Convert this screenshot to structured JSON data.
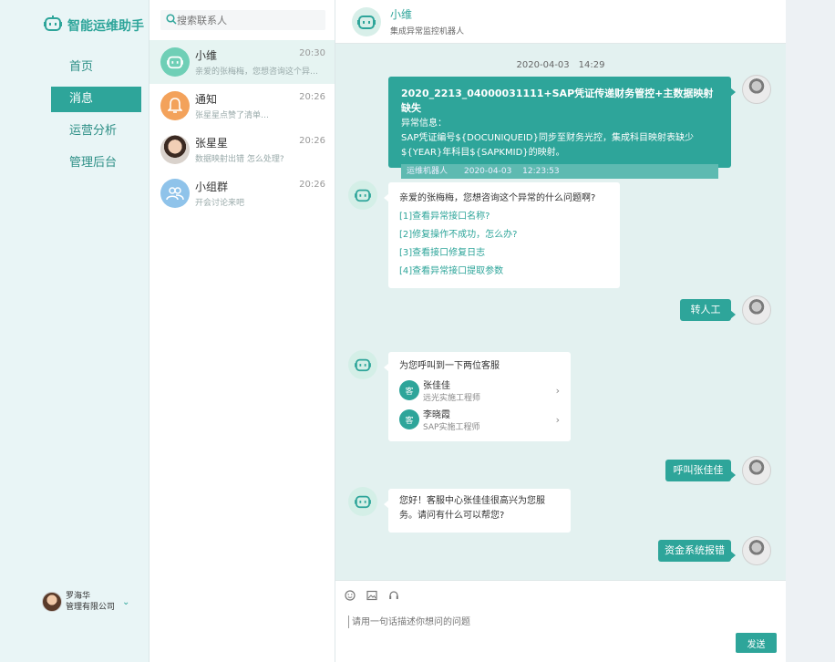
{
  "app": {
    "title": "智能运维助手"
  },
  "nav": {
    "items": [
      {
        "label": "首页",
        "active": false
      },
      {
        "label": "消息",
        "active": true
      },
      {
        "label": "运营分析",
        "active": false
      },
      {
        "label": "管理后台",
        "active": false
      }
    ]
  },
  "user": {
    "name": "罗海华",
    "company": "管理有限公司"
  },
  "search": {
    "placeholder": "搜索联系人"
  },
  "contacts": [
    {
      "name": "小维",
      "preview": "亲爱的张梅梅，您想咨询这个异…",
      "time": "20:30",
      "avatar": "robot-icon",
      "color": "#6fcfb6"
    },
    {
      "name": "通知",
      "preview": "张星星点赞了清单…",
      "time": "20:26",
      "avatar": "bell-icon",
      "color": "#f3a25b"
    },
    {
      "name": "张星星",
      "preview": "数据映射出错 怎么处理?",
      "time": "20:26",
      "avatar": "person-photo",
      "color": "#d9c4b0"
    },
    {
      "name": "小组群",
      "preview": "开会讨论来吧",
      "time": "20:26",
      "avatar": "group-icon",
      "color": "#8fc3ea"
    }
  ],
  "chat": {
    "title": "小维",
    "subtitle": "集成异常监控机器人",
    "timestamp": "2020-04-03　14:29",
    "alert": {
      "title": "2020_2213_04000031111+SAP凭证传递财务管控+主数据映射缺失",
      "label": "异常信息：",
      "line1": "SAP凭证编号${DOCUNIQUEID}同步至财务光控，集成科目映射表缺少",
      "line2": "${YEAR}年科目${SAPKMID}的映射。",
      "footer": "运维机器人　　2020-04-03　 12:23:53"
    },
    "question": {
      "text": "亲爱的张梅梅，您想咨询这个异常的什么问题啊?",
      "options": [
        "[1]查看异常接口名称?",
        "[2]修复操作不成功，怎么办?",
        "[3]查看接口修复日志",
        "[4]查看异常接口提取参数"
      ]
    },
    "reply1": "转人工",
    "agents": {
      "text": "为您呼叫到一下两位客服",
      "badge": "客",
      "list": [
        {
          "name": "张佳佳",
          "role": "远光实施工程师"
        },
        {
          "name": "李晓霞",
          "role": "SAP实施工程师"
        }
      ]
    },
    "reply2": "呼叫张佳佳",
    "greeting": {
      "line1": "您好！客服中心张佳佳很高兴为您服",
      "line2": "务。请问有什么可以帮您?"
    },
    "reply3": "资金系统报错"
  },
  "compose": {
    "placeholder": "请用一句话描述你想问的问题",
    "send": "发送"
  },
  "colors": {
    "accent": "#2ea59a",
    "chat_bg": "#e3f1f0",
    "nav_bg": "#e9f5f6"
  }
}
